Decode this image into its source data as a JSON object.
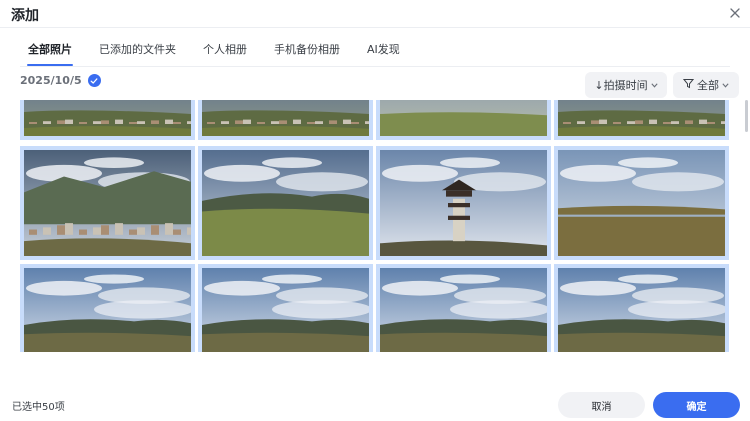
{
  "dialog": {
    "title": "添加",
    "close_icon": "close-icon"
  },
  "tabs": [
    {
      "label": "全部照片",
      "active": true
    },
    {
      "label": "已添加的文件夹",
      "active": false
    },
    {
      "label": "个人相册",
      "active": false
    },
    {
      "label": "手机备份相册",
      "active": false
    },
    {
      "label": "AI发现",
      "active": false
    }
  ],
  "section": {
    "date": "2025/10/5",
    "check_icon": "check-circle-icon"
  },
  "filters": {
    "sort_label": "↓拍摄时间",
    "all_label": "全部",
    "filter_icon": "funnel-icon",
    "dropdown_icon": "chevron-down-icon"
  },
  "photos": [
    {
      "subject": "town-valley"
    },
    {
      "subject": "town-hillside"
    },
    {
      "subject": "grassland"
    },
    {
      "subject": "town-buildings"
    },
    {
      "subject": "mountain-town"
    },
    {
      "subject": "hills-meadow"
    },
    {
      "subject": "watchtower"
    },
    {
      "subject": "flat-grassland"
    },
    {
      "subject": "sky-hills"
    },
    {
      "subject": "sky-hills"
    },
    {
      "subject": "sky-hills"
    },
    {
      "subject": "sky-hills"
    }
  ],
  "footer": {
    "selected_count": "已选中50项",
    "cancel_label": "取消",
    "ok_label": "确定"
  },
  "colors": {
    "accent": "#3a6df0",
    "selection_border": "#c8dcfb",
    "button_gray": "#f1f2f5"
  }
}
